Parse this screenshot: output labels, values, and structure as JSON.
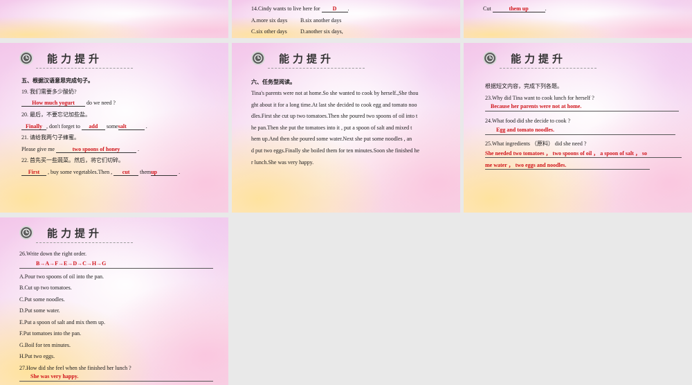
{
  "header_title": "能力提升",
  "slide_top_mid": {
    "q14": "14.Cindy wants to live here for",
    "q14_answer": "D",
    "opt_a": "A.more six days",
    "opt_b": "B.six another days",
    "opt_c": "C.six other days",
    "opt_d": "D.another six days,"
  },
  "slide_top_right": {
    "cut": "Cut",
    "answer": "them up"
  },
  "slide_left": {
    "section": "五、根据汉语意思完成句子。",
    "q19": "19. 我们需要多少酸奶?",
    "q19_answer": "How much yogurt",
    "q19_tail": "do we need ?",
    "q20": "20. 最后，不要忘记加些盐。",
    "q20_ans1": "Finally",
    "q20_mid": "don't forget to",
    "q20_ans2": "add",
    "q20_some": "some",
    "q20_ans3": "salt",
    "q21": "21. 请给我两勺子蜂蜜。",
    "q21_lead": "Please give me",
    "q21_answer": "two spoons of honey",
    "q22": "22. 首先买一些蔬菜。然后，将它们切碎。",
    "q22_ans1": "First",
    "q22_mid": "buy some vegetables.Then ,",
    "q22_ans2": "cut",
    "q22_them": "them",
    "q22_ans3": "up"
  },
  "slide_mid": {
    "section": "六、任务型阅读。",
    "lines": [
      "Tina's parents were not at home.So she wanted to cook by herself.,She thou",
      "ght about it for a long time.At last she decided to cook egg and tomato noo",
      "dles.First she cut up two tomatoes.Then she poured two spoons of oil into t",
      "he pan.Then she put the tomatoes  into it ,  put a spoon of salt and mixed t",
      "hem up.And then she poured some water.Next she put some  noodles ,  an",
      "d put two eggs.Finally she boiled them for ten minutes.Soon she finished he",
      "r lunch.She was very happy."
    ]
  },
  "slide_right": {
    "intro": "根据短文内容，完成下列各题。",
    "q23": "23.Why did Tina want to cook lunch for herself ?",
    "q23_answer": "Because her parents were not at home.",
    "q24": "24.What food did she decide to cook ?",
    "q24_answer": "Egg and tomato noodles.",
    "q25": "25.What ingredients （原料） did she need ?",
    "q25_answer_line1": "She needed two tomatoes ，  two spoons of oil ，  a spoon of salt ，  so",
    "q25_answer_line2": "me water ，  two eggs and noodles."
  },
  "slide_bottom": {
    "q26": "26.Write down the right order.",
    "q26_answer": "B→A→F→E→D→C→H→G",
    "items": [
      "A.Pour two spoons of oil into the pan.",
      "B.Cut up two tomatoes.",
      "C.Put some noodles.",
      "D.Put some water.",
      "E.Put a spoon of salt and mix them up.",
      "F.Put tomatoes into the pan.",
      "G.Boil for ten minutes.",
      "H.Put two eggs."
    ],
    "q27": "27.How did she feel when she finished her lunch ?",
    "q27_answer": "She was very happy."
  }
}
